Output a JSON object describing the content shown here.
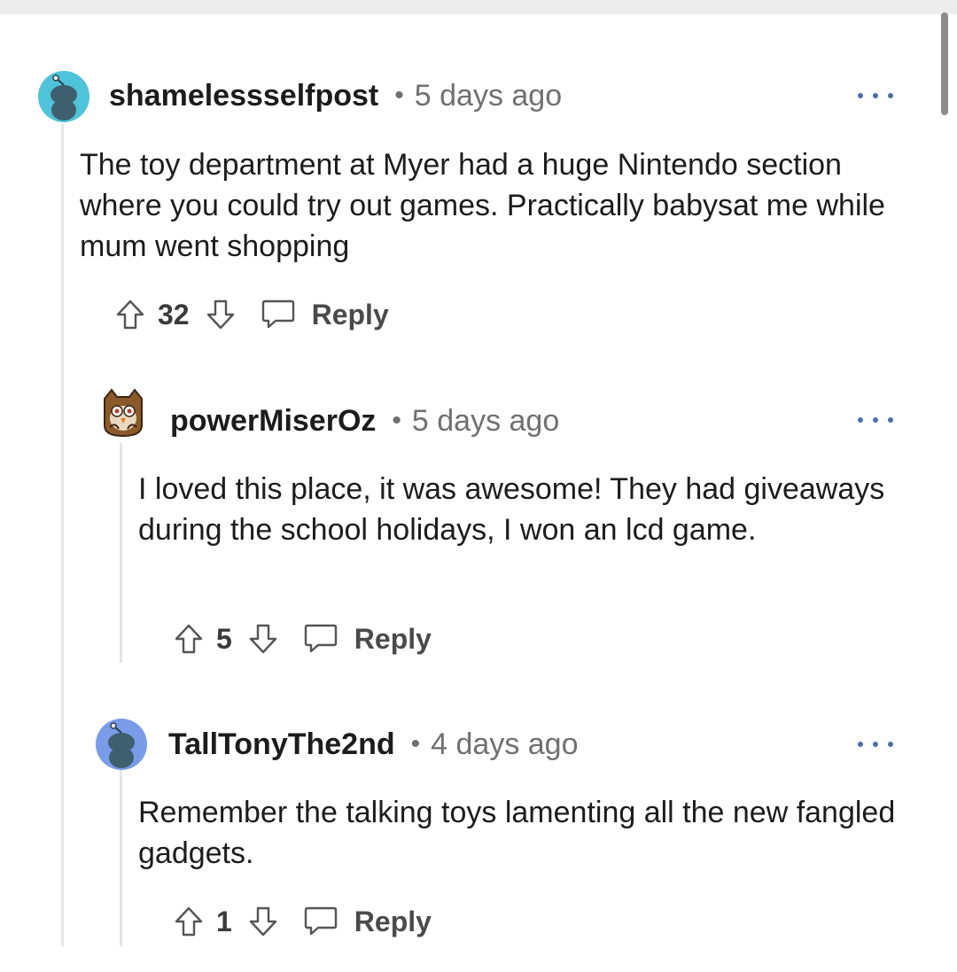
{
  "comments": [
    {
      "username": "shamelessselfpost",
      "separator": "•",
      "time": "5 days ago",
      "body": "The toy department at Myer had a huge Nintendo section where you could try out games. Practically babysat me while mum went shopping",
      "votes": "32",
      "reply_label": "Reply",
      "avatar_color": "#4fc3d9"
    },
    {
      "username": "powerMiserOz",
      "separator": "•",
      "time": "5 days ago",
      "body": "I loved this place, it was awesome! They had giveaways during the school holidays, I won an lcd game.",
      "votes": "5",
      "reply_label": "Reply",
      "avatar_color": "#8a5a2b"
    },
    {
      "username": "TallTonyThe2nd",
      "separator": "•",
      "time": "4 days ago",
      "body": "Remember the talking toys lamenting all the new fangled gadgets.",
      "votes": "1",
      "reply_label": "Reply",
      "avatar_color": "#7a9be8"
    }
  ],
  "icons": {
    "upvote": "upvote-arrow-icon",
    "downvote": "downvote-arrow-icon",
    "reply": "speech-bubble-icon",
    "more": "more-options-dots-icon"
  }
}
